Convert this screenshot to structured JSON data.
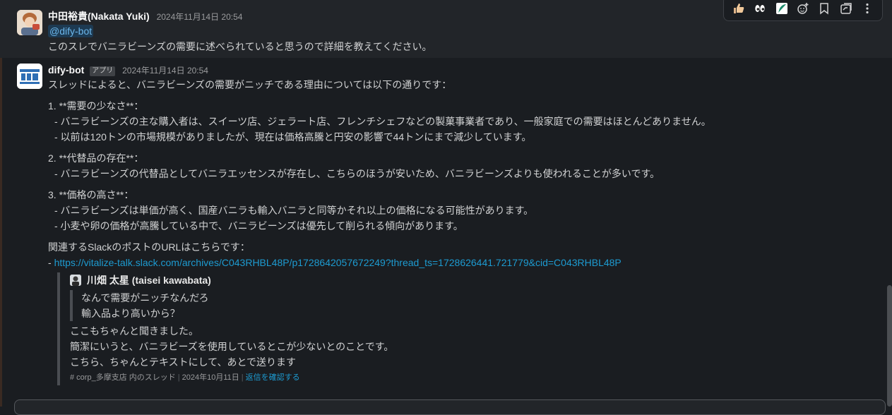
{
  "toolbar": {
    "icons": [
      "thumbs-up-icon",
      "eyes-icon",
      "feather-icon",
      "add-reaction-icon",
      "bookmark-icon",
      "forward-icon",
      "more-icon"
    ]
  },
  "message1": {
    "author": "中田裕貴(Nakata Yuki)",
    "timestamp": "2024年11月14日 20:54",
    "mention": "@dify-bot",
    "text": "このスレでバニラビーンズの需要に述べられていると思うので詳細を教えてください。"
  },
  "message2": {
    "author": "dify-bot",
    "badge": "アプリ",
    "timestamp": "2024年11月14日 20:54",
    "intro": "スレッドによると、バニラビーンズの需要がニッチである理由については以下の通りです：",
    "sections": [
      {
        "heading": "1. **需要の少なさ**：",
        "bullets": [
          "- バニラビーンズの主な購入者は、スイーツ店、ジェラート店、フレンチシェフなどの製菓事業者であり、一般家庭での需要はほとんどありません。",
          "- 以前は120トンの市場規模がありましたが、現在は価格高騰と円安の影響で44トンにまで減少しています。"
        ]
      },
      {
        "heading": "2. **代替品の存在**：",
        "bullets": [
          "- バニラビーンズの代替品としてバニラエッセンスが存在し、こちらのほうが安いため、バニラビーンズよりも使われることが多いです。"
        ]
      },
      {
        "heading": "3. **価格の高さ**：",
        "bullets": [
          "- バニラビーンズは単価が高く、国産バニラも輸入バニラと同等かそれ以上の価格になる可能性があります。",
          "- 小麦や卵の価格が高騰している中で、バニラビーンズは優先して削られる傾向があります。"
        ]
      }
    ],
    "related_label": "関連するSlackのポストのURLはこちらです：",
    "link_prefix": "- ",
    "link": "https://vitalize-talk.slack.com/archives/C043RHBL48P/p1728642057672249?thread_ts=1728626441.721779&cid=C043RHBL48P"
  },
  "quote": {
    "author": "川畑 太星 (taisei kawabata)",
    "inner_lines": [
      "なんで需要がニッチなんだろ",
      "輸入品より高いから？"
    ],
    "lines": [
      "ここもちゃんと聞きました。",
      "簡潔にいうと、バニラビーズを使用しているとこが少ないとのことです。",
      "こちら、ちゃんとテキストにして、あとで送ります"
    ],
    "channel": "# corp_多摩支店 内のスレッド",
    "date": "2024年10月11日",
    "reply_link": "返信を確認する"
  }
}
